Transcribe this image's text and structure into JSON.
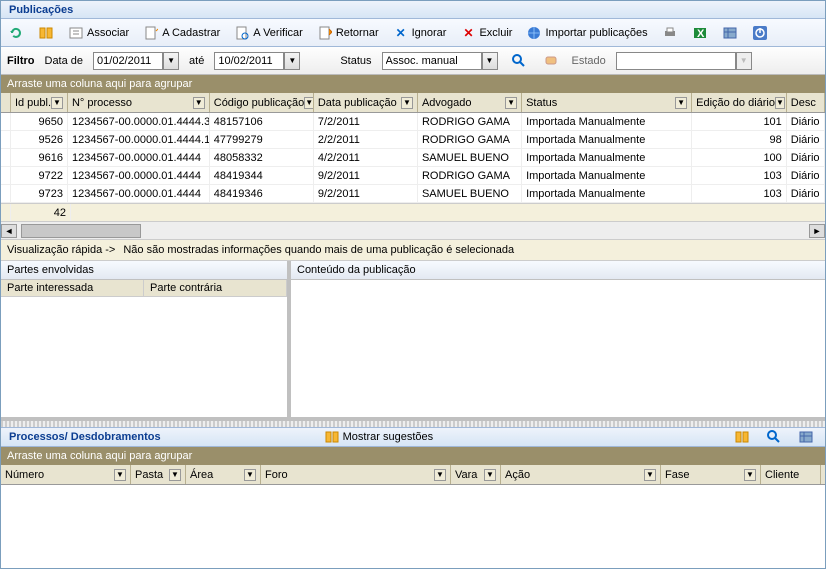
{
  "titles": {
    "main": "Publicações",
    "section2": "Processos/ Desdobramentos"
  },
  "toolbar": {
    "associar": "Associar",
    "acadastrar": "A Cadastrar",
    "averificar": "A Verificar",
    "retornar": "Retornar",
    "ignorar": "Ignorar",
    "excluir": "Excluir",
    "importar": "Importar publicações"
  },
  "filter": {
    "label": "Filtro",
    "data_de_lbl": "Data de",
    "data_de": "01/02/2011",
    "ate_lbl": "até",
    "data_ate": "10/02/2011",
    "status_lbl": "Status",
    "status_val": "Assoc. manual",
    "estado_lbl": "Estado"
  },
  "grid": {
    "group_hint": "Arraste uma coluna aqui para agrupar",
    "headers": {
      "id": "Id publ.",
      "proc": "N° processo",
      "cod": "Código publicação",
      "datap": "Data publicação",
      "adv": "Advogado",
      "stat": "Status",
      "ed": "Edição do diário",
      "desc": "Desc"
    },
    "rows": [
      {
        "id": "9650",
        "proc": "1234567-00.0000.01.4444.3",
        "cod": "48157106",
        "datap": "7/2/2011",
        "adv": "RODRIGO GAMA",
        "stat": "Importada Manualmente",
        "ed": "101",
        "desc": "Diário"
      },
      {
        "id": "9526",
        "proc": "1234567-00.0000.01.4444.1",
        "cod": "47799279",
        "datap": "2/2/2011",
        "adv": "RODRIGO GAMA",
        "stat": "Importada Manualmente",
        "ed": "98",
        "desc": "Diário"
      },
      {
        "id": "9616",
        "proc": "1234567-00.0000.01.4444",
        "cod": "48058332",
        "datap": "4/2/2011",
        "adv": "SAMUEL BUENO",
        "stat": "Importada Manualmente",
        "ed": "100",
        "desc": "Diário"
      },
      {
        "id": "9722",
        "proc": "1234567-00.0000.01.4444",
        "cod": "48419344",
        "datap": "9/2/2011",
        "adv": "RODRIGO GAMA",
        "stat": "Importada Manualmente",
        "ed": "103",
        "desc": "Diário"
      },
      {
        "id": "9723",
        "proc": "1234567-00.0000.01.4444",
        "cod": "48419346",
        "datap": "9/2/2011",
        "adv": "SAMUEL BUENO",
        "stat": "Importada Manualmente",
        "ed": "103",
        "desc": "Diário"
      }
    ],
    "sum_count": "42"
  },
  "quickview": {
    "label": "Visualização rápida ->",
    "msg": "Não são mostradas informações quando mais de uma publicação é selecionada"
  },
  "panels": {
    "partes": "Partes envolvidas",
    "parte_int": "Parte interessada",
    "parte_con": "Parte contrária",
    "conteudo": "Conteúdo da publicação"
  },
  "section2": {
    "mostrar": "Mostrar sugestões",
    "group_hint": "Arraste uma coluna aqui para agrupar",
    "headers": {
      "num": "Número",
      "pasta": "Pasta",
      "area": "Área",
      "foro": "Foro",
      "vara": "Vara",
      "acao": "Ação",
      "fase": "Fase",
      "cliente": "Cliente"
    }
  }
}
